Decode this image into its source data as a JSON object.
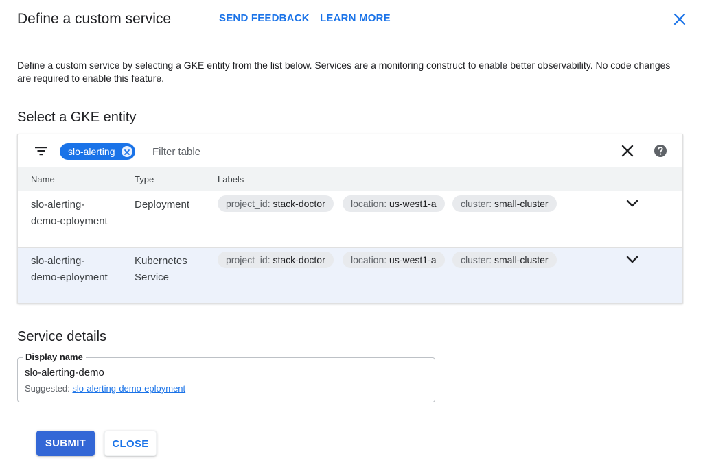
{
  "header": {
    "title": "Define a custom service",
    "send_feedback": "SEND FEEDBACK",
    "learn_more": "LEARN MORE"
  },
  "intro": "Define a custom service by selecting a GKE entity from the list below. Services are a monitoring construct to enable better observability. No code changes are required to enable this feature.",
  "entity_section": {
    "heading": "Select a GKE entity",
    "filter_chip": "slo-alerting",
    "filter_placeholder": "Filter table",
    "columns": {
      "name": "Name",
      "type": "Type",
      "labels": "Labels"
    },
    "rows": [
      {
        "name": "slo-alerting-demo-eployment",
        "type": "Deployment",
        "selected": false,
        "labels": [
          {
            "key": "project_id:",
            "value": "stack-doctor"
          },
          {
            "key": "location:",
            "value": "us-west1-a"
          },
          {
            "key": "cluster:",
            "value": "small-cluster"
          }
        ]
      },
      {
        "name": "slo-alerting-demo-eployment",
        "type": "Kubernetes Service",
        "selected": true,
        "labels": [
          {
            "key": "project_id:",
            "value": "stack-doctor"
          },
          {
            "key": "location:",
            "value": "us-west1-a"
          },
          {
            "key": "cluster:",
            "value": "small-cluster"
          }
        ]
      }
    ]
  },
  "service_details": {
    "heading": "Service details",
    "display_name_label": "Display name",
    "display_name_value": "slo-alerting-demo",
    "suggested_prefix": "Suggested:",
    "suggested_value": "slo-alerting-demo-eployment"
  },
  "actions": {
    "submit": "SUBMIT",
    "close": "CLOSE"
  },
  "colors": {
    "accent": "#1a73e8",
    "submit_bg": "#3367d6",
    "selected_row_bg": "#edf2fb",
    "label_chip_bg": "#e8eaed"
  },
  "icons": {
    "close": "close-icon",
    "filter": "filter-list-icon",
    "chip_remove": "cancel-circle-icon",
    "clear_filter": "close-icon",
    "help": "help-circle-icon",
    "expand": "chevron-down-icon"
  }
}
